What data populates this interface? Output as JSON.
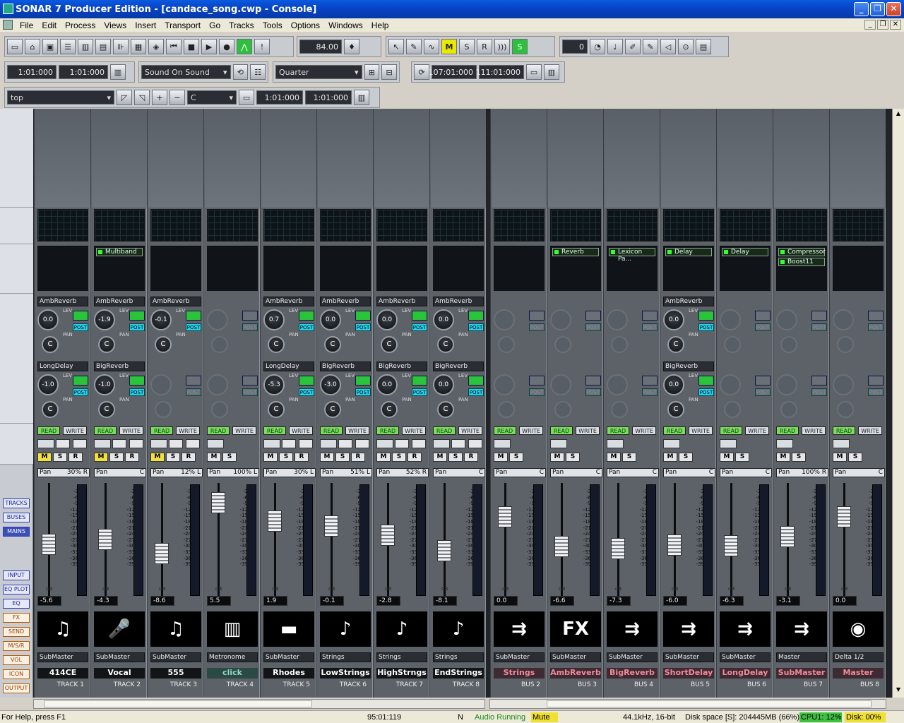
{
  "window": {
    "title": "SONAR 7 Producer Edition - [candace_song.cwp - Console]",
    "buttons": [
      "_",
      "❐",
      "✕"
    ],
    "mdi_buttons": [
      "_",
      "❐",
      "✕"
    ]
  },
  "menu": [
    "File",
    "Edit",
    "Process",
    "Views",
    "Insert",
    "Transport",
    "Go",
    "Tracks",
    "Tools",
    "Options",
    "Windows",
    "Help"
  ],
  "toolbar": {
    "tempo": "84.00",
    "snap_count": "0",
    "now_time": "1:01:000",
    "punch_in": "1:01:000",
    "sound_on_sound": "Sound On Sound",
    "snap": "Quarter",
    "loop_start": "107:01:000",
    "loop_end": "111:01:000",
    "track_select": "top",
    "key": "C",
    "sel_start": "1:01:000",
    "sel_end": "1:01:000",
    "msr_buttons": [
      "M",
      "S",
      "R"
    ]
  },
  "leftpanel": {
    "buttons": [
      "TRACKS",
      "BUSES",
      "MAINS"
    ],
    "buttons2": [
      "INPUT",
      "EQ PLOT",
      "EQ",
      "FX",
      "SEND",
      "M/S/R",
      "VOL",
      "ICON",
      "OUTPUT"
    ]
  },
  "strips": [
    {
      "kind": "track",
      "fx": [],
      "send1": "AmbReverb",
      "lev1": "0.0",
      "send2": "LongDelay",
      "lev2": "-1.0",
      "pan": "30% R",
      "db": "-5.6",
      "icon": "guitar",
      "out": "SubMaster",
      "name": "414CE",
      "label": "TRACK 1"
    },
    {
      "kind": "track",
      "fx": [
        "Multiband"
      ],
      "send1": "AmbReverb",
      "lev1": "-1.9",
      "send2": "BigReverb",
      "lev2": "-1.0",
      "pan": "C",
      "db": "-4.3",
      "icon": "mic",
      "out": "SubMaster",
      "name": "Vocal",
      "label": "TRACK 2"
    },
    {
      "kind": "track",
      "fx": [],
      "send1": "AmbReverb",
      "lev1": "-0.1",
      "send2": "",
      "lev2": "",
      "pan": "12% L",
      "db": "-8.6",
      "icon": "guitar",
      "out": "SubMaster",
      "name": "555",
      "label": "TRACK 3"
    },
    {
      "kind": "click",
      "fx": [],
      "send1": "",
      "lev1": "",
      "send2": "",
      "lev2": "",
      "pan": "100% L",
      "db": "5.5",
      "icon": "keys",
      "out": "Metronome",
      "name": "click",
      "label": "TRACK 4"
    },
    {
      "kind": "track",
      "fx": [],
      "send1": "AmbReverb",
      "lev1": "0.7",
      "send2": "LongDelay",
      "lev2": "-5.3",
      "pan": "30% L",
      "db": "1.9",
      "icon": "rhodes",
      "out": "SubMaster",
      "name": "Rhodes",
      "label": "TRACK 5"
    },
    {
      "kind": "track",
      "fx": [],
      "send1": "AmbReverb",
      "lev1": "0.0",
      "send2": "BigReverb",
      "lev2": "-3.0",
      "pan": "51% L",
      "db": "-0.1",
      "icon": "violin",
      "out": "Strings",
      "name": "LowStrings",
      "label": "TRACK 6"
    },
    {
      "kind": "track",
      "fx": [],
      "send1": "AmbReverb",
      "lev1": "0.0",
      "send2": "BigReverb",
      "lev2": "0.0",
      "pan": "52% R",
      "db": "-2.8",
      "icon": "violin",
      "out": "Strings",
      "name": "HighStrngs",
      "label": "TRACK 7"
    },
    {
      "kind": "track",
      "fx": [],
      "send1": "AmbReverb",
      "lev1": "0.0",
      "send2": "BigReverb",
      "lev2": "0.0",
      "pan": "C",
      "db": "-8.1",
      "icon": "violin",
      "out": "Strings",
      "name": "EndStrings",
      "label": "TRACK 8"
    },
    {
      "kind": "bus",
      "fx": [],
      "send1": "",
      "lev1": "",
      "send2": "",
      "lev2": "",
      "pan": "C",
      "db": "0.0",
      "icon": "arrow",
      "out": "SubMaster",
      "name": "Strings",
      "label": "BUS 2"
    },
    {
      "kind": "bus",
      "fx": [
        "Reverb"
      ],
      "send1": "",
      "lev1": "",
      "send2": "",
      "lev2": "",
      "pan": "C",
      "db": "-6.6",
      "icon": "FX",
      "out": "SubMaster",
      "name": "AmbReverb",
      "label": "BUS 3"
    },
    {
      "kind": "bus",
      "fx": [
        "Lexicon Pa..."
      ],
      "send1": "",
      "lev1": "",
      "send2": "",
      "lev2": "",
      "pan": "C",
      "db": "-7.3",
      "icon": "arrow",
      "out": "SubMaster",
      "name": "BigReverb",
      "label": "BUS 4"
    },
    {
      "kind": "bus",
      "fx": [
        "Delay"
      ],
      "send1": "AmbReverb",
      "lev1": "0.0",
      "send2": "BigReverb",
      "lev2": "0.0",
      "pan": "C",
      "db": "-6.0",
      "icon": "arrow",
      "out": "SubMaster",
      "name": "ShortDelay",
      "label": "BUS 5"
    },
    {
      "kind": "bus",
      "fx": [
        "Delay"
      ],
      "send1": "",
      "lev1": "",
      "send2": "",
      "lev2": "",
      "pan": "C",
      "db": "-6.3",
      "icon": "arrow",
      "out": "SubMaster",
      "name": "LongDelay",
      "label": "BUS 6"
    },
    {
      "kind": "bus",
      "fx": [
        "Compressor",
        "Boost11"
      ],
      "send1": "",
      "lev1": "",
      "send2": "",
      "lev2": "",
      "pan": "100% R",
      "db": "-3.1",
      "icon": "arrow",
      "out": "Master",
      "name": "SubMaster",
      "label": "BUS 7"
    },
    {
      "kind": "bus",
      "fx": [],
      "send1": "",
      "lev1": "",
      "send2": "",
      "lev2": "",
      "pan": "C",
      "db": "0.0",
      "icon": "target",
      "out": "Delta 1/2",
      "name": "Master",
      "label": "BUS 8"
    }
  ],
  "labels": {
    "read": "READ",
    "write": "WRITE",
    "post": "POST",
    "pan": "Pan",
    "lev": "LEV",
    "pan_small": "PAN",
    "db": "dB",
    "c": "C"
  },
  "scale": [
    "-3",
    "-6",
    "-9",
    "-12",
    "-15",
    "-18",
    "-21",
    "-24",
    "-27",
    "-30",
    "-33",
    "-36",
    "-39"
  ],
  "status": {
    "help": "For Help, press F1",
    "time": "95:01:119",
    "n": "N",
    "audio": "Audio Running",
    "mute": "Mute",
    "format": "44.1kHz, 16-bit",
    "disk": "Disk space [S]: 204445MB (66%)",
    "cpu": "CPU1: 12%",
    "diskpct": "Disk: 00%"
  }
}
